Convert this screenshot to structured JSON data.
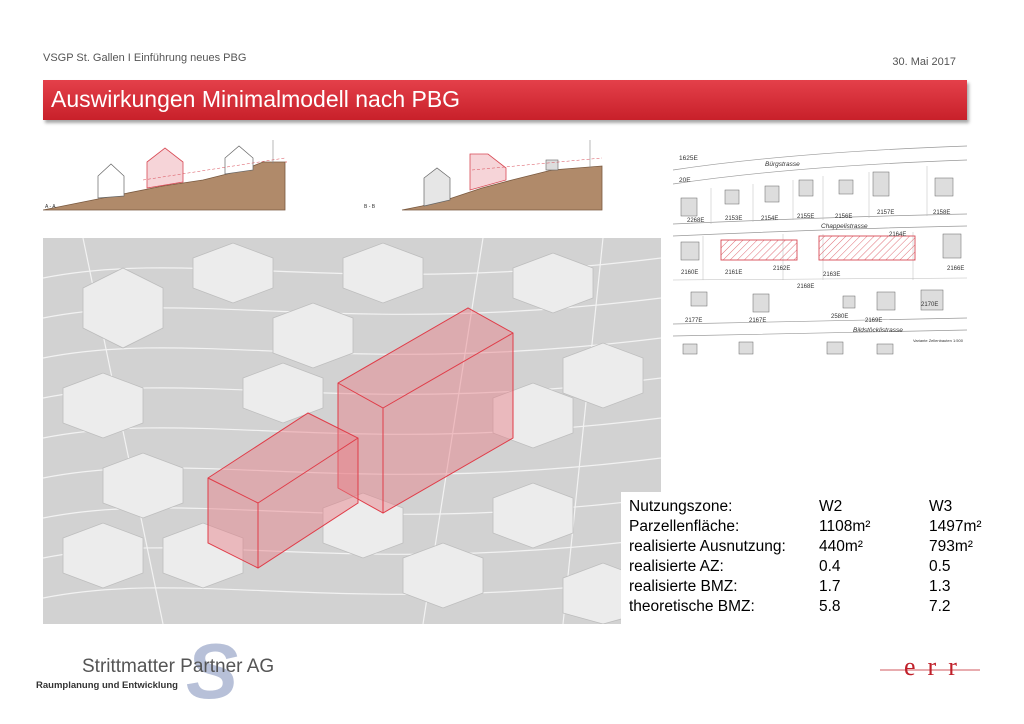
{
  "header": {
    "left_text": "VSGP St. Gallen I Einführung neues PBG",
    "date": "30. Mai 2017"
  },
  "title": "Auswirkungen Minimalmodell nach PBG",
  "sections": {
    "aa_label": "A - A",
    "bb_label": "B - B"
  },
  "plan": {
    "streets": [
      "Bürgstrasse",
      "Chappelistrasse",
      "Bildstöcklistrasse"
    ],
    "parcels": [
      "1625E",
      "20E",
      "2268E",
      "2153E",
      "2154E",
      "2155E",
      "2156E",
      "2157E",
      "2158E",
      "2164E",
      "2160E",
      "2161E",
      "2162E",
      "2163E",
      "2166E",
      "2168E",
      "2177E",
      "2167E",
      "2580E",
      "2169E",
      "2170E"
    ],
    "legend": "Variante Zellenbauten 1:500"
  },
  "stats": {
    "rows": [
      {
        "label": "Nutzungszone:",
        "w2": "W2",
        "w3": "W3"
      },
      {
        "label": "Parzellenfläche:",
        "w2": "1108m²",
        "w3": "1497m²"
      },
      {
        "label": "realisierte Ausnutzung:",
        "w2": "440m²",
        "w3": "793m²"
      },
      {
        "label": "realisierte AZ:",
        "w2": "0.4",
        "w3": "0.5"
      },
      {
        "label": "realisierte BMZ:",
        "w2": "1.7",
        "w3": "1.3"
      },
      {
        "label": "theoretische BMZ:",
        "w2": "5.8",
        "w3": "7.2"
      }
    ]
  },
  "footer": {
    "logo_name": "Strittmatter Partner AG",
    "logo_sub": "Raumplanung und Entwicklung",
    "logo_letter": "S",
    "right_logo": "err"
  },
  "colors": {
    "title_bar": "#d42c34",
    "accent_red": "#c0202a",
    "volume_fill": "#e8a0a6"
  }
}
